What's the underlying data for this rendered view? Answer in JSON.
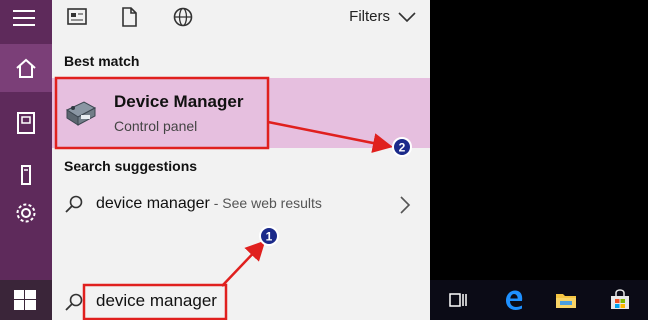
{
  "panel": {
    "filters_label": "Filters",
    "best_match_heading": "Best match",
    "best_match": {
      "title": "Device Manager",
      "subtitle": "Control panel"
    },
    "suggestions_heading": "Search suggestions",
    "suggestion": {
      "query": "device manager",
      "hint": " - See web results"
    }
  },
  "search": {
    "value": "device manager"
  },
  "annotations": {
    "step1": "1",
    "step2": "2"
  },
  "icons": {
    "rail": [
      "hamburger-icon",
      "home-icon",
      "documents-icon",
      "tower-icon",
      "settings-icon"
    ],
    "topbar": [
      "apps-icon",
      "document-icon",
      "web-globe-icon"
    ],
    "taskbar": [
      "task-view-icon",
      "edge-icon",
      "file-explorer-icon",
      "store-icon"
    ]
  },
  "colors": {
    "rail": "#5e2a5b",
    "highlight": "#e6bfdf",
    "annotation": "#e0201e"
  }
}
